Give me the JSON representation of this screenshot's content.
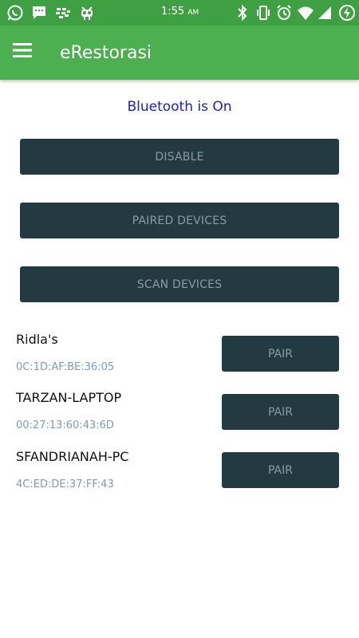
{
  "status_bar": {
    "time": "1:55",
    "ampm": "AM",
    "left_icons": [
      "whatsapp-icon",
      "message-icon",
      "blackberry-icon",
      "android-icon"
    ],
    "right_icons": [
      "bluetooth-icon",
      "vibrate-icon",
      "alarm-icon",
      "wifi-icon",
      "signal-icon",
      "battery-charging-icon"
    ],
    "color": "#3ea043"
  },
  "app_bar": {
    "title": "eRestorasi",
    "menu_icon": "hamburger-menu-icon",
    "color": "#4caf50"
  },
  "bluetooth": {
    "status_text": "Bluetooth is On"
  },
  "buttons": {
    "disable": "DISABLE",
    "paired": "PAIRED DEVICES",
    "scan": "SCAN DEVICES"
  },
  "devices": [
    {
      "name": "Ridla's",
      "mac": "0C:1D:AF:BE:36:05",
      "action": "PAIR"
    },
    {
      "name": "TARZAN-LAPTOP",
      "mac": "00:27:13:60:43:6D",
      "action": "PAIR"
    },
    {
      "name": "SFANDRIANAH-PC",
      "mac": "4C:ED:DE:37:FF:43",
      "action": "PAIR"
    }
  ],
  "colors": {
    "button_bg": "#233a43",
    "button_text": "#8d9aa1",
    "status_text": "#1f1fb0",
    "mac_text": "#7d9ab3"
  }
}
